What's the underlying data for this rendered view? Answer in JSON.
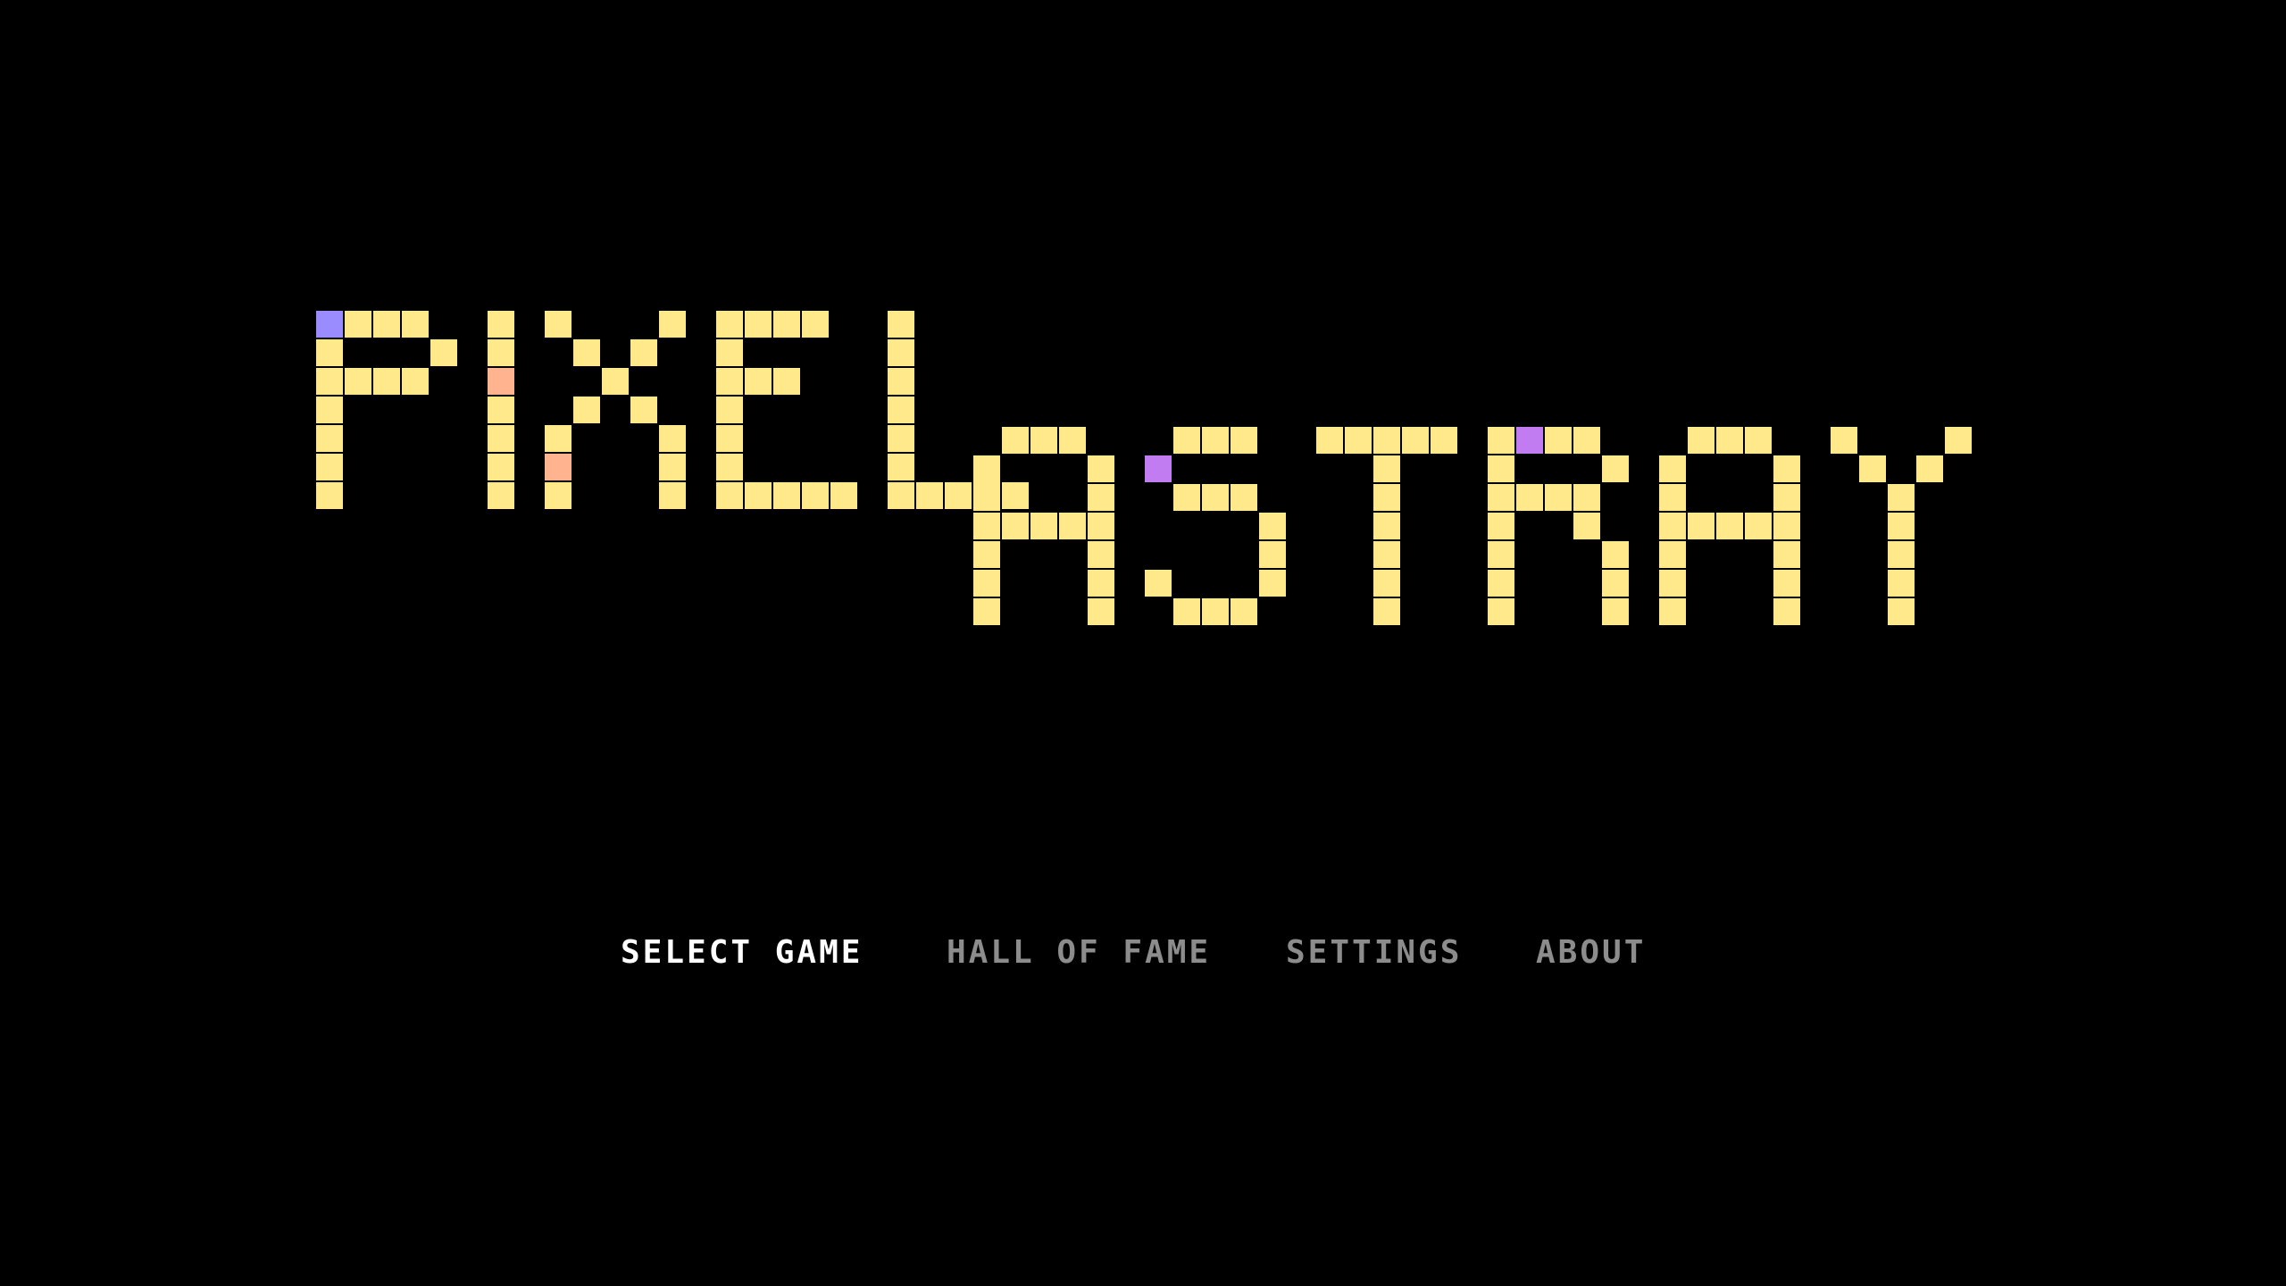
{
  "logo": {
    "text": "PIXEL ASTRAY",
    "words": [
      "PIXEL",
      "ASTRAY"
    ],
    "palette": [
      "#ffe98a",
      "#9fd4ff",
      "#7ef6ff",
      "#7cf0c2",
      "#9a8cff",
      "#7ff3a8",
      "#ff6fa3",
      "#96ff99",
      "#ffb38f",
      "#c27cf2",
      "#87a3ff",
      "#fff08a",
      "#b592ff",
      "#e58fe6",
      "#ffb77a",
      "#a6ff6e"
    ]
  },
  "menu": {
    "items": [
      {
        "id": "select-game",
        "label": "SELECT GAME",
        "selected": true
      },
      {
        "id": "hall-of-fame",
        "label": "HALL OF FAME",
        "selected": false
      },
      {
        "id": "settings",
        "label": "SETTINGS",
        "selected": false
      },
      {
        "id": "about",
        "label": "ABOUT",
        "selected": false
      }
    ],
    "selected_color": "#ffffff",
    "unselected_color": "#8c8c8c"
  }
}
